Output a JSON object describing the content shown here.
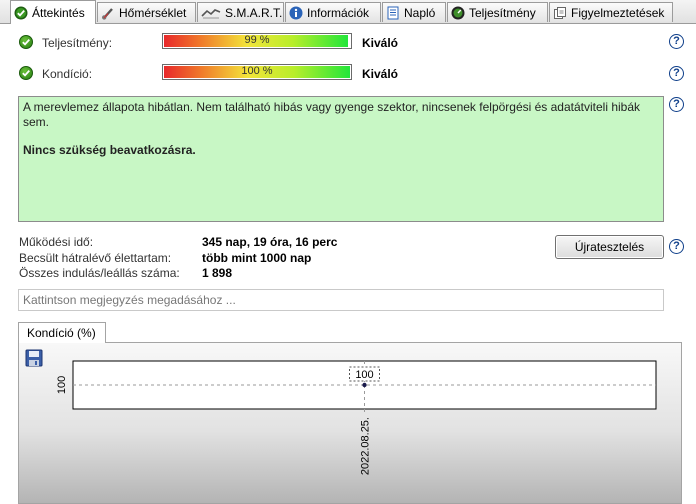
{
  "tabs": [
    {
      "label": "Áttekintés",
      "icon": "check-circle-icon",
      "active": true
    },
    {
      "label": "Hőmérséklet",
      "icon": "thermometer-icon",
      "active": false
    },
    {
      "label": "S.M.A.R.T.",
      "icon": "smart-icon",
      "active": false
    },
    {
      "label": "Információk",
      "icon": "info-icon",
      "active": false
    },
    {
      "label": "Napló",
      "icon": "document-icon",
      "active": false
    },
    {
      "label": "Teljesítmény",
      "icon": "performance-icon",
      "active": false
    },
    {
      "label": "Figyelmeztetések",
      "icon": "warnings-icon",
      "active": false
    }
  ],
  "metrics": [
    {
      "label": "Teljesítmény:",
      "value_text": "99 %",
      "value": 0.99,
      "rating": "Kiváló"
    },
    {
      "label": "Kondíció:",
      "value_text": "100 %",
      "value": 1.0,
      "rating": "Kiváló"
    }
  ],
  "status": {
    "text": "A merevlemez állapota hibátlan. Nem található hibás vagy gyenge szektor, nincsenek felpörgési és adatátviteli hibák sem.",
    "action": "Nincs szükség beavatkozásra."
  },
  "info": [
    {
      "label": "Működési idő:",
      "value": "345 nap, 19 óra, 16 perc"
    },
    {
      "label": "Becsült hátralévő élettartam:",
      "value": "több mint 1000 nap"
    },
    {
      "label": "Összes indulás/leállás száma:",
      "value": "1 898"
    }
  ],
  "retest_button": "Újratesztelés",
  "note_placeholder": "Kattintson megjegyzés megadásához ...",
  "chart_tab": "Kondíció  (%)",
  "colors": {
    "status_bg": "#c8f7c5",
    "good": "#237a12",
    "help": "#0f3f8a"
  },
  "chart_data": {
    "type": "line",
    "x": [
      "2022.08.25."
    ],
    "y": [
      100
    ],
    "series": [
      {
        "values": [
          100
        ]
      }
    ],
    "data_labels": [
      "100"
    ],
    "y_tick_labels": [
      "100"
    ],
    "x_tick_labels": [
      "2022.08.25."
    ],
    "grid": true
  }
}
